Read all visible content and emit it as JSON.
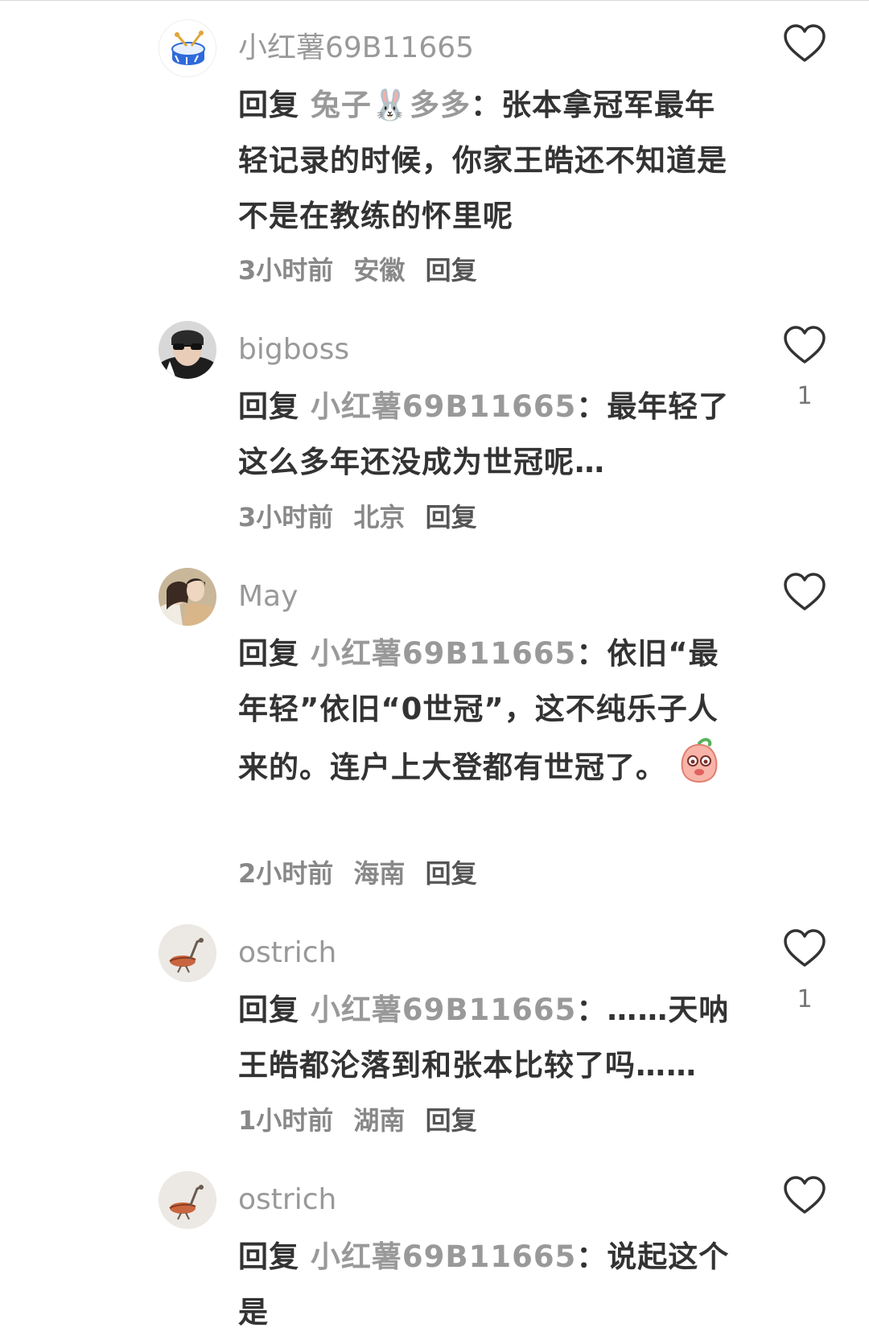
{
  "comments": [
    {
      "username": "小红薯69B11665",
      "reply_prefix": "回复",
      "reply_target": "兔子🐰多多",
      "separator": "：",
      "text": "张本拿冠军最年轻记录的时候，你家王皓还不知道是不是在教练的怀里呢",
      "time": "3小时前",
      "location": "安徽",
      "reply_label": "回复",
      "like_count": ""
    },
    {
      "username": "bigboss",
      "reply_prefix": "回复",
      "reply_target": "小红薯69B11665",
      "separator": "：",
      "text": "最年轻了这么多年还没成为世冠呢…",
      "time": "3小时前",
      "location": "北京",
      "reply_label": "回复",
      "like_count": "1"
    },
    {
      "username": "May",
      "reply_prefix": "回复",
      "reply_target": "小红薯69B11665",
      "separator": "：",
      "text": "依旧“最年轻”依旧“0世冠”，这不纯乐子人来的。连户上大登都有世冠了。",
      "time": "2小时前",
      "location": "海南",
      "reply_label": "回复",
      "like_count": ""
    },
    {
      "username": "ostrich",
      "reply_prefix": "回复",
      "reply_target": "小红薯69B11665",
      "separator": "：",
      "text": "……天呐王皓都沦落到和张本比较了吗……",
      "time": "1小时前",
      "location": "湖南",
      "reply_label": "回复",
      "like_count": "1"
    },
    {
      "username": "ostrich",
      "reply_prefix": "回复",
      "reply_target": "小红薯69B11665",
      "separator": "：",
      "text": "说起这个是",
      "time": "",
      "location": "",
      "reply_label": "",
      "like_count": ""
    }
  ],
  "icons": {
    "like": "heart-outline-icon",
    "avatar_1": "drum-avatar",
    "emoji": "peach-shy-emoji"
  },
  "colors": {
    "username": "#999999",
    "body": "#333333",
    "meta": "#888888",
    "heart": "#333333"
  }
}
